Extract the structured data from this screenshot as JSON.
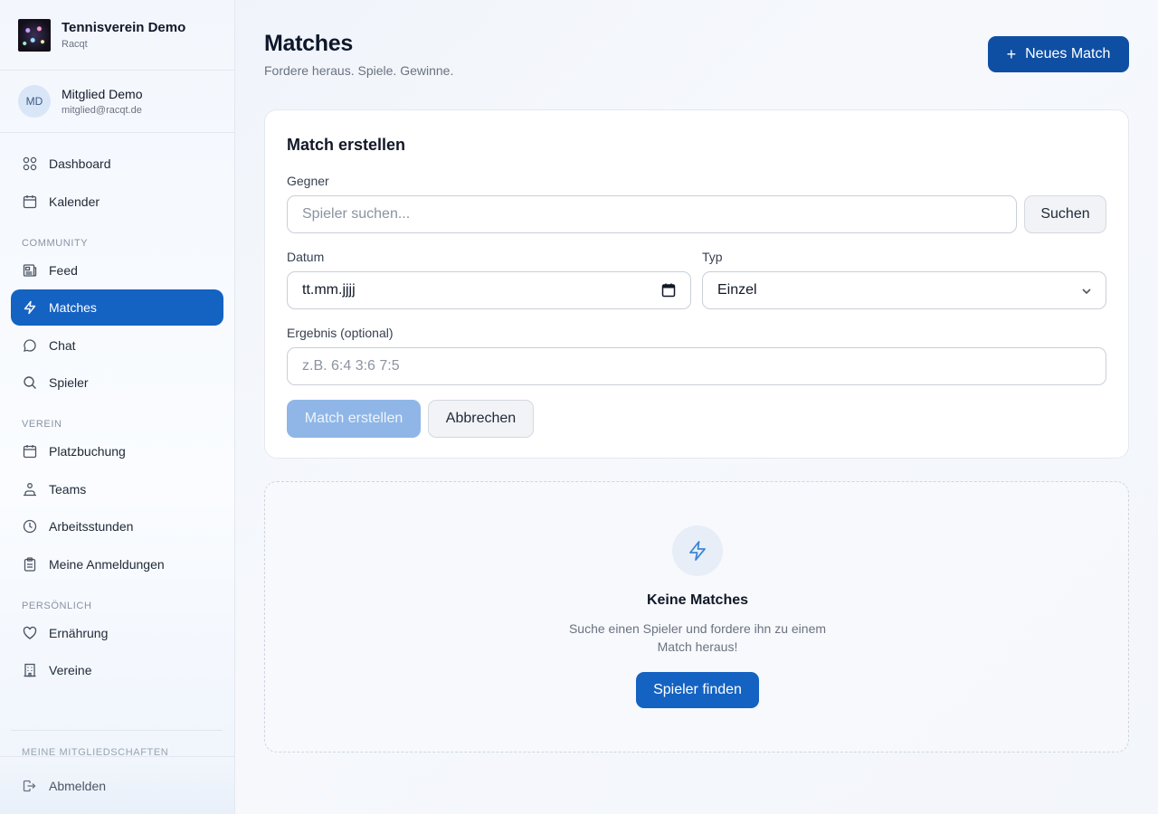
{
  "brand": {
    "title": "Tennisverein Demo",
    "subtitle": "Racqt"
  },
  "user": {
    "initials": "MD",
    "name": "Mitglied Demo",
    "email": "mitglied@racqt.de"
  },
  "nav": {
    "top": [
      {
        "label": "Dashboard",
        "icon": "dashboard-icon"
      },
      {
        "label": "Kalender",
        "icon": "calendar-icon"
      }
    ],
    "community_label": "COMMUNITY",
    "community": [
      {
        "label": "Feed",
        "icon": "newspaper-icon"
      },
      {
        "label": "Matches",
        "icon": "lightning-icon",
        "active": true
      },
      {
        "label": "Chat",
        "icon": "chat-bubble-icon"
      },
      {
        "label": "Spieler",
        "icon": "search-icon"
      }
    ],
    "verein_label": "VEREIN",
    "verein": [
      {
        "label": "Platzbuchung",
        "icon": "calendar-icon"
      },
      {
        "label": "Teams",
        "icon": "team-icon"
      },
      {
        "label": "Arbeitsstunden",
        "icon": "clock-icon"
      },
      {
        "label": "Meine Anmeldungen",
        "icon": "clipboard-icon"
      }
    ],
    "personal_label": "PERSÖNLICH",
    "personal": [
      {
        "label": "Ernährung",
        "icon": "heart-icon"
      },
      {
        "label": "Vereine",
        "icon": "building-icon"
      }
    ],
    "memberships_label": "MEINE MITGLIEDSCHAFTEN",
    "logout": "Abmelden"
  },
  "header": {
    "title": "Matches",
    "subtitle": "Fordere heraus. Spiele. Gewinne.",
    "new_button": "Neues Match"
  },
  "form": {
    "title": "Match erstellen",
    "opponent_label": "Gegner",
    "opponent_placeholder": "Spieler suchen...",
    "search_button": "Suchen",
    "date_label": "Datum",
    "date_value": "tt.mm.jjjj",
    "type_label": "Typ",
    "type_value": "Einzel",
    "result_label": "Ergebnis (optional)",
    "result_placeholder": "z.B. 6:4 3:6 7:5",
    "create_button": "Match erstellen",
    "cancel_button": "Abbrechen"
  },
  "empty": {
    "title": "Keine Matches",
    "text": "Suche einen Spieler und fordere ihn zu einem Match heraus!",
    "button": "Spieler finden"
  },
  "colors": {
    "accent": "#1462c2",
    "accent_dark": "#0e4fa3",
    "disabled": "#8fb6e6"
  }
}
